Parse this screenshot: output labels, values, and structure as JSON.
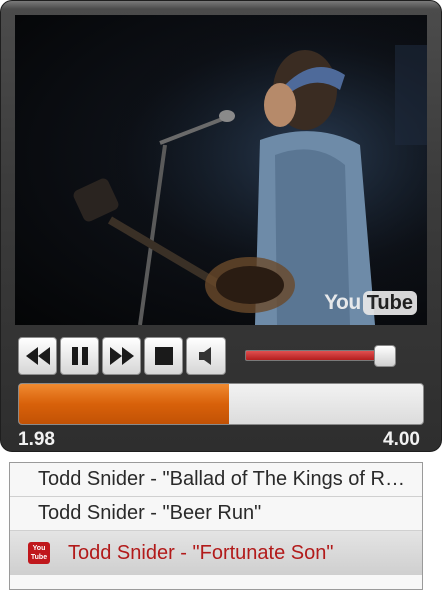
{
  "player": {
    "logo": {
      "you": "You",
      "tube": "Tube"
    },
    "controls": [
      "rewind-icon",
      "pause-icon",
      "fast-forward-icon",
      "stop-icon",
      "speaker-icon"
    ],
    "volume_level": 0.93,
    "progress_fraction": 0.52,
    "time_current": "1.98",
    "time_total": "4.00",
    "colors": {
      "progress": "#d8610a",
      "volume": "#c0282d"
    }
  },
  "playlist": {
    "items": [
      {
        "label": "Todd Snider - \"Ballad of The Kings of Rock and Roll\""
      },
      {
        "label": "Todd Snider - \"Beer Run\""
      },
      {
        "label": "Todd Snider - \"Fortunate Son\"",
        "icon": "youtube-icon",
        "icon_text_top": "You",
        "icon_text_bottom": "Tube"
      }
    ]
  }
}
